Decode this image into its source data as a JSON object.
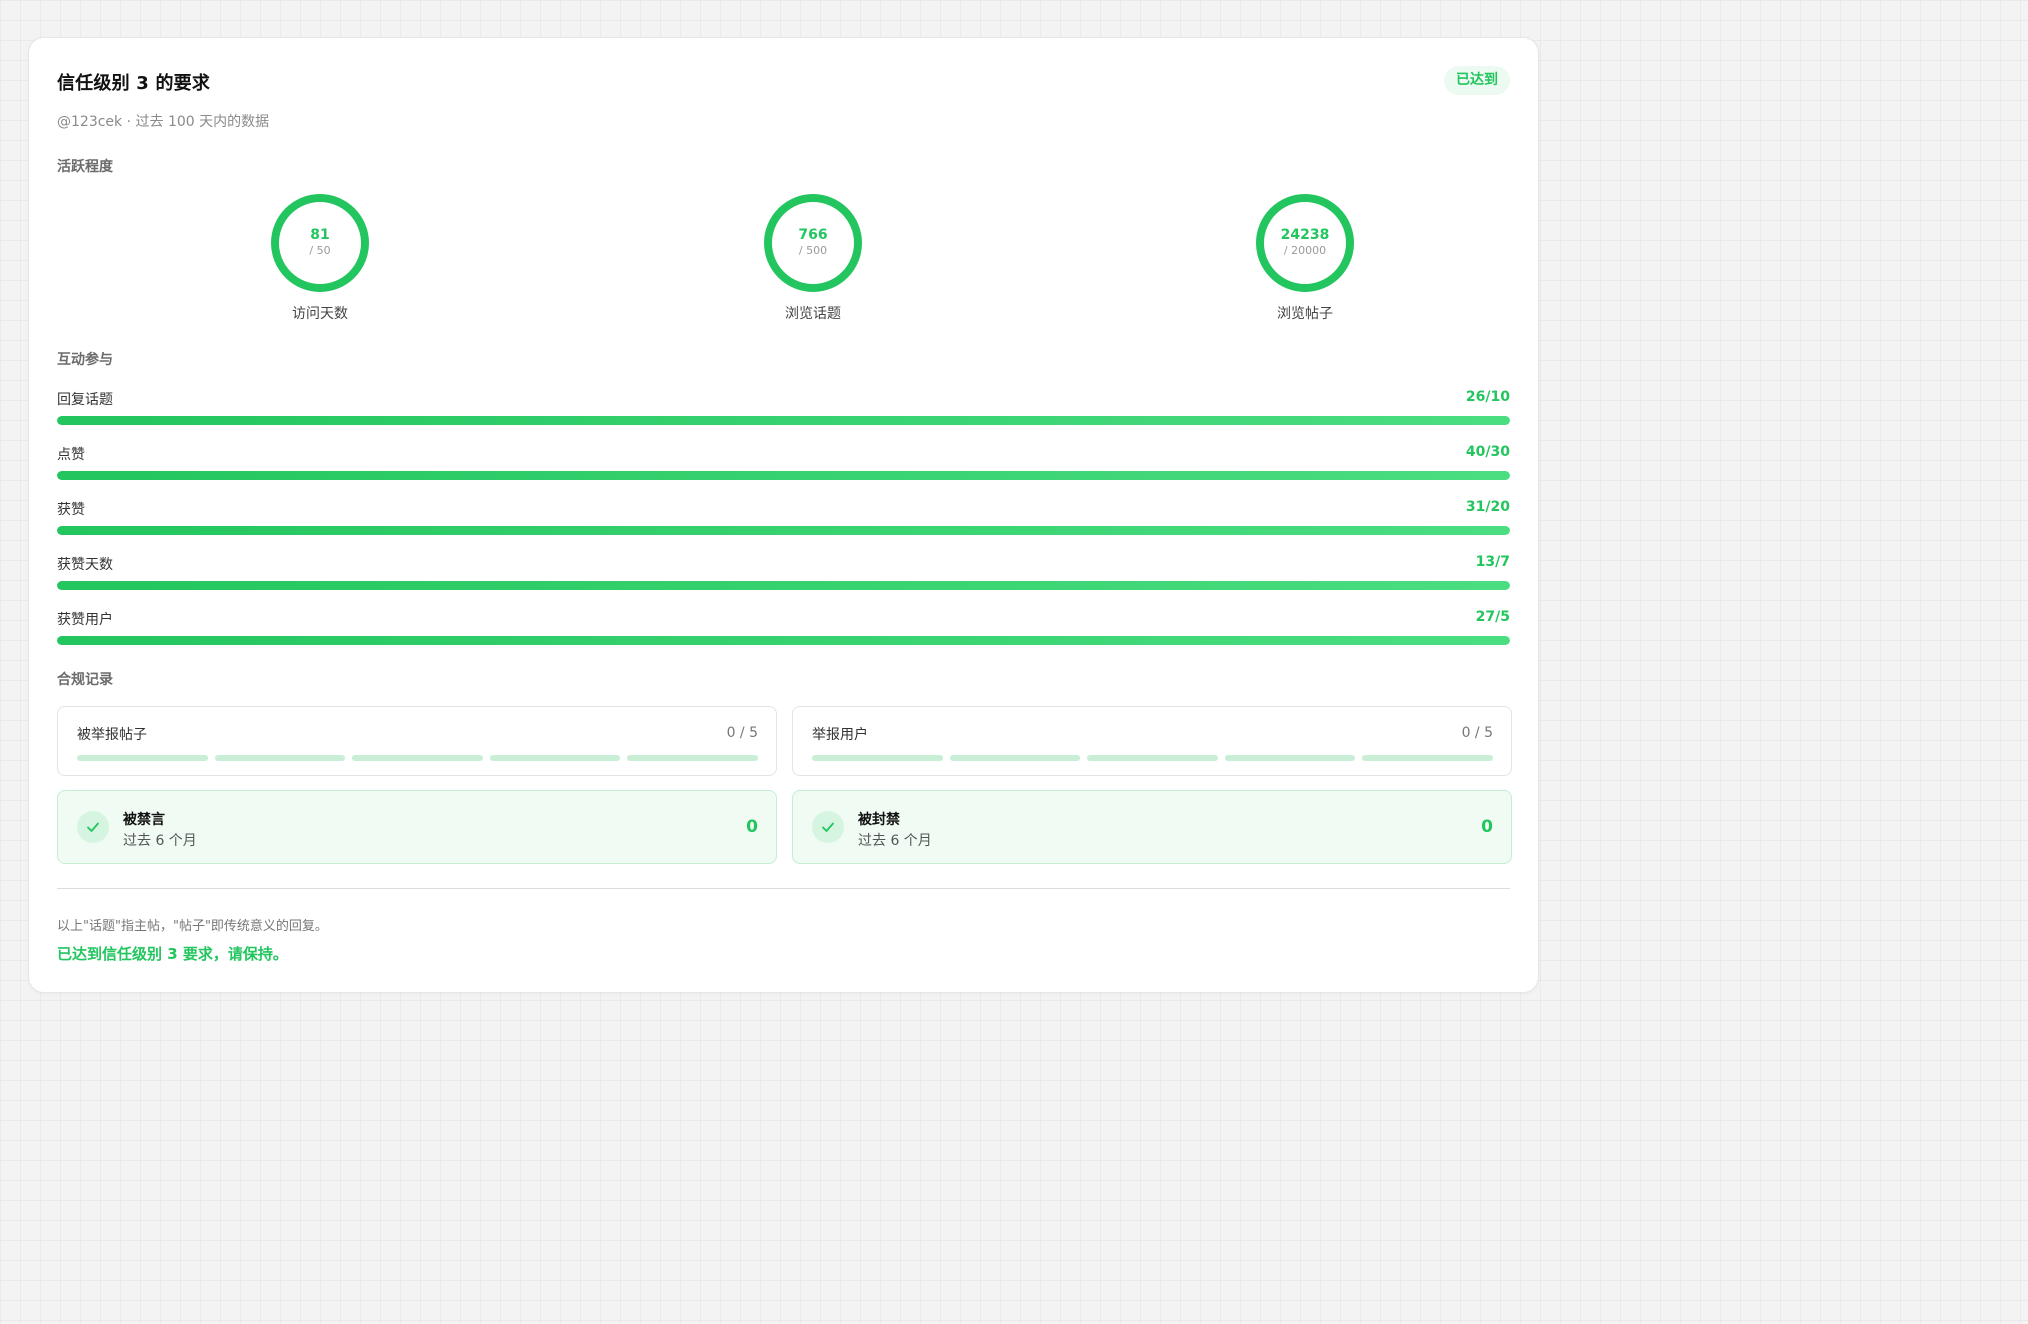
{
  "header": {
    "title": "信任级别 3 的要求",
    "badge": "已达到",
    "subtitle": "@123cek · 过去 100 天内的数据"
  },
  "activity": {
    "label": "活跃程度",
    "metrics": [
      {
        "value": "81",
        "target": "/ 50",
        "label": "访问天数"
      },
      {
        "value": "766",
        "target": "/ 500",
        "label": "浏览话题"
      },
      {
        "value": "24238",
        "target": "/ 20000",
        "label": "浏览帖子"
      }
    ]
  },
  "interaction": {
    "label": "互动参与",
    "items": [
      {
        "label": "回复话题",
        "value": "26/10",
        "progress": 1.0
      },
      {
        "label": "点赞",
        "value": "40/30",
        "progress": 1.0
      },
      {
        "label": "获赞",
        "value": "31/20",
        "progress": 1.0
      },
      {
        "label": "获赞天数",
        "value": "13/7",
        "progress": 1.0
      },
      {
        "label": "获赞用户",
        "value": "27/5",
        "progress": 1.0
      }
    ]
  },
  "compliance": {
    "label": "合规记录",
    "reports": [
      {
        "label": "被举报帖子",
        "value": "0 / 5"
      },
      {
        "label": "举报用户",
        "value": "0 / 5"
      }
    ],
    "penalties": [
      {
        "title": "被禁言",
        "sub": "过去 6 个月",
        "count": "0"
      },
      {
        "title": "被封禁",
        "sub": "过去 6 个月",
        "count": "0"
      }
    ]
  },
  "footer": {
    "note": "以上\"话题\"指主帖，\"帖子\"即传统意义的回复。",
    "status": "已达到信任级别 3 要求，请保持。"
  },
  "colors": {
    "accent": "#22c55e",
    "accent_light": "#4ade80",
    "success_bg": "#f0fbf4",
    "segment": "#c8eed6"
  },
  "icons": {
    "penalty_ok": "check-icon"
  }
}
